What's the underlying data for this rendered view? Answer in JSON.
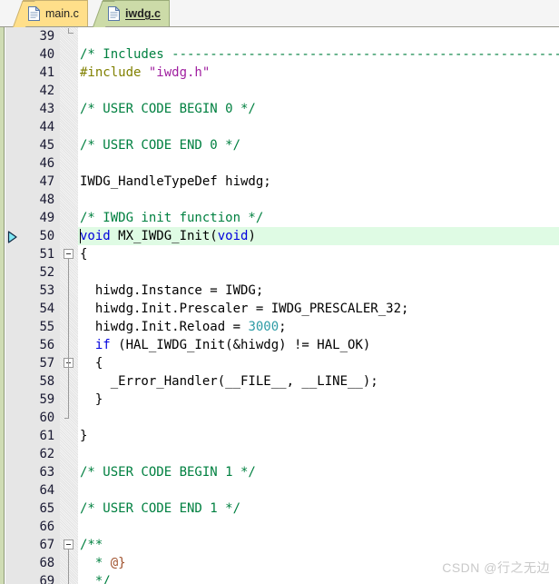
{
  "window": {
    "title": "iwdg.c",
    "watermark": "CSDN @行之无边"
  },
  "tabs": [
    {
      "label": "main.c",
      "icon": "document-icon",
      "active": false
    },
    {
      "label": "iwdg.c",
      "icon": "document-icon",
      "active": true
    }
  ],
  "editor": {
    "first_visible_line": 39,
    "last_visible_line": 69,
    "cursor_line": 50,
    "cursor_column": 1,
    "highlighted_line": 50,
    "marker_arrow_line": 50,
    "colors": {
      "comment": "#008040",
      "preprocessor": "#808000",
      "string": "#a020a0",
      "keyword": "#0000dd",
      "number": "#2e9ca6",
      "doc_tag": "#a0522d",
      "current_line_highlight": "#dffbe4",
      "gutter_background": "#e6e6e6",
      "active_tab_background": "#ccdba8",
      "inactive_tab_background": "#ffdf8a"
    },
    "lines": [
      {
        "n": 39,
        "tokens": []
      },
      {
        "n": 40,
        "tokens": [
          {
            "t": "/* Includes ------------------------------------------------------------------",
            "c": "c-com"
          }
        ]
      },
      {
        "n": 41,
        "tokens": [
          {
            "t": "#include ",
            "c": "c-pre"
          },
          {
            "t": "\"iwdg.h\"",
            "c": "c-str"
          }
        ]
      },
      {
        "n": 42,
        "tokens": []
      },
      {
        "n": 43,
        "tokens": [
          {
            "t": "/* USER CODE BEGIN 0 */",
            "c": "c-com"
          }
        ]
      },
      {
        "n": 44,
        "tokens": []
      },
      {
        "n": 45,
        "tokens": [
          {
            "t": "/* USER CODE END 0 */",
            "c": "c-com"
          }
        ]
      },
      {
        "n": 46,
        "tokens": []
      },
      {
        "n": 47,
        "tokens": [
          {
            "t": "IWDG_HandleTypeDef hiwdg;",
            "c": "c-plain"
          }
        ]
      },
      {
        "n": 48,
        "tokens": []
      },
      {
        "n": 49,
        "tokens": [
          {
            "t": "/* IWDG init function */",
            "c": "c-com"
          }
        ]
      },
      {
        "n": 50,
        "tokens": [
          {
            "t": "void",
            "c": "c-kw"
          },
          {
            "t": " MX_IWDG_Init(",
            "c": "c-plain"
          },
          {
            "t": "void",
            "c": "c-kw"
          },
          {
            "t": ")",
            "c": "c-plain"
          }
        ]
      },
      {
        "n": 51,
        "tokens": [
          {
            "t": "{",
            "c": "c-plain"
          }
        ]
      },
      {
        "n": 52,
        "tokens": []
      },
      {
        "n": 53,
        "tokens": [
          {
            "t": "  hiwdg.Instance = IWDG;",
            "c": "c-plain"
          }
        ]
      },
      {
        "n": 54,
        "tokens": [
          {
            "t": "  hiwdg.Init.Prescaler = IWDG_PRESCALER_32;",
            "c": "c-plain"
          }
        ]
      },
      {
        "n": 55,
        "tokens": [
          {
            "t": "  hiwdg.Init.Reload = ",
            "c": "c-plain"
          },
          {
            "t": "3000",
            "c": "c-num"
          },
          {
            "t": ";",
            "c": "c-plain"
          }
        ]
      },
      {
        "n": 56,
        "tokens": [
          {
            "t": "  ",
            "c": "c-plain"
          },
          {
            "t": "if",
            "c": "c-kw"
          },
          {
            "t": " (HAL_IWDG_Init(&hiwdg) != HAL_OK)",
            "c": "c-plain"
          }
        ]
      },
      {
        "n": 57,
        "tokens": [
          {
            "t": "  {",
            "c": "c-plain"
          }
        ]
      },
      {
        "n": 58,
        "tokens": [
          {
            "t": "    _Error_Handler(__FILE__, __LINE__);",
            "c": "c-plain"
          }
        ]
      },
      {
        "n": 59,
        "tokens": [
          {
            "t": "  }",
            "c": "c-plain"
          }
        ]
      },
      {
        "n": 60,
        "tokens": []
      },
      {
        "n": 61,
        "tokens": [
          {
            "t": "}",
            "c": "c-plain"
          }
        ]
      },
      {
        "n": 62,
        "tokens": []
      },
      {
        "n": 63,
        "tokens": [
          {
            "t": "/* USER CODE BEGIN 1 */",
            "c": "c-com"
          }
        ]
      },
      {
        "n": 64,
        "tokens": []
      },
      {
        "n": 65,
        "tokens": [
          {
            "t": "/* USER CODE END 1 */",
            "c": "c-com"
          }
        ]
      },
      {
        "n": 66,
        "tokens": []
      },
      {
        "n": 67,
        "tokens": [
          {
            "t": "/**",
            "c": "c-com"
          }
        ]
      },
      {
        "n": 68,
        "tokens": [
          {
            "t": "  * ",
            "c": "c-com"
          },
          {
            "t": "@}",
            "c": "c-doc"
          }
        ]
      },
      {
        "n": 69,
        "tokens": [
          {
            "t": "  */",
            "c": "c-com"
          }
        ]
      }
    ],
    "fold_boxes": [
      51,
      57,
      67
    ],
    "fold_end_39": true
  }
}
